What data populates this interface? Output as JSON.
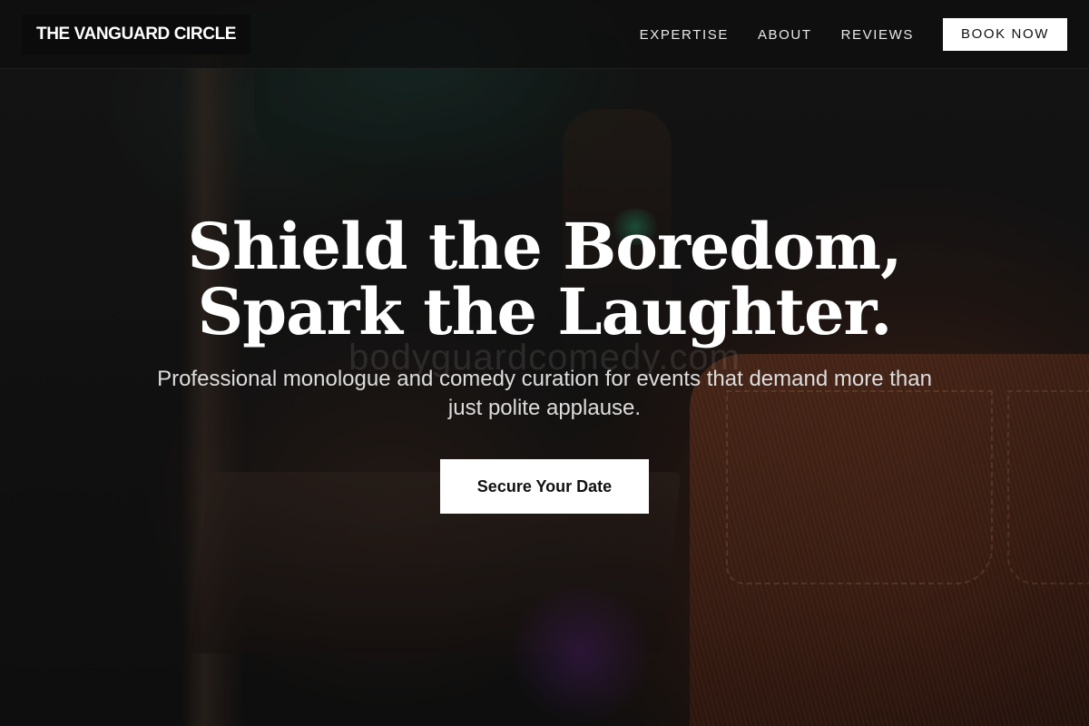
{
  "header": {
    "logo_text": "THE VANGUARD CIRCLE",
    "nav": [
      {
        "label": "EXPERTISE"
      },
      {
        "label": "ABOUT"
      },
      {
        "label": "REVIEWS"
      }
    ],
    "book_label": "BOOK NOW"
  },
  "hero": {
    "title_line1": "Shield the Boredom,",
    "title_line2": "Spark the Laughter.",
    "subtitle": "Professional monologue and comedy curation for events that demand more than just polite applause.",
    "cta_label": "Secure Your Date",
    "watermark_text": "bodyguardcomedy.com"
  },
  "colors": {
    "header_bg": "#0e0e0e",
    "logo_bg": "#0b0b0b",
    "text_primary": "#ffffff",
    "button_bg": "#ffffff",
    "button_text": "#111111"
  }
}
